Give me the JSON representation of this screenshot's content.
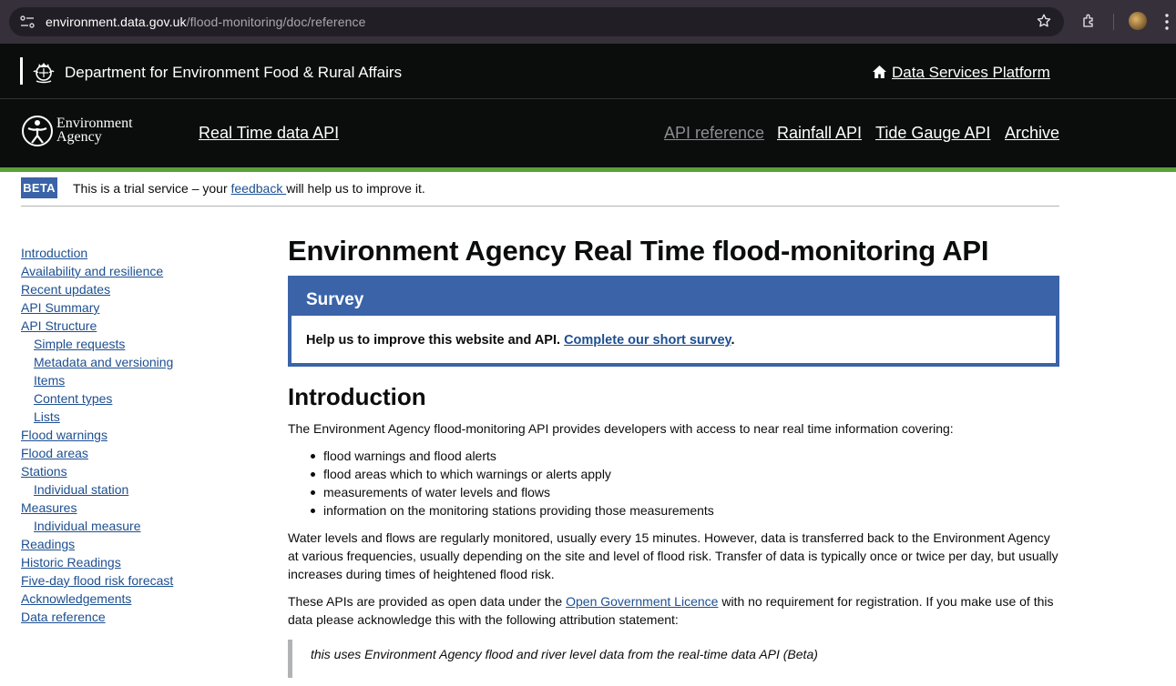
{
  "browser": {
    "url_host": "environment.data.gov.uk",
    "url_path": "/flood-monitoring/doc/reference"
  },
  "defra_header": {
    "department": "Department for Environment Food & Rural Affairs",
    "platform_link": "Data Services Platform"
  },
  "ea_header": {
    "logo_line1": "Environment",
    "logo_line2": "Agency",
    "service_name": "Real Time data API",
    "nav": [
      "API reference",
      "Rainfall API",
      "Tide Gauge API",
      "Archive"
    ],
    "active_nav": "API reference"
  },
  "beta": {
    "tag": "BETA",
    "text_before": "This is a trial service – your ",
    "link": "feedback ",
    "text_after": "will help us to improve it."
  },
  "sidebar": {
    "items": [
      {
        "label": "Introduction",
        "sub": false
      },
      {
        "label": "Availability and resilience",
        "sub": false
      },
      {
        "label": "Recent updates",
        "sub": false
      },
      {
        "label": "API Summary",
        "sub": false
      },
      {
        "label": "API Structure",
        "sub": false
      },
      {
        "label": "Simple requests",
        "sub": true
      },
      {
        "label": "Metadata and versioning",
        "sub": true
      },
      {
        "label": "Items",
        "sub": true
      },
      {
        "label": "Content types",
        "sub": true
      },
      {
        "label": "Lists",
        "sub": true
      },
      {
        "label": "Flood warnings",
        "sub": false
      },
      {
        "label": "Flood areas",
        "sub": false
      },
      {
        "label": "Stations",
        "sub": false
      },
      {
        "label": "Individual station",
        "sub": true
      },
      {
        "label": "Measures",
        "sub": false
      },
      {
        "label": "Individual measure",
        "sub": true
      },
      {
        "label": "Readings",
        "sub": false
      },
      {
        "label": "Historic Readings",
        "sub": false
      },
      {
        "label": "Five-day flood risk forecast",
        "sub": false
      },
      {
        "label": "Acknowledgements",
        "sub": false
      },
      {
        "label": "Data reference",
        "sub": false
      }
    ]
  },
  "main": {
    "title": "Environment Agency Real Time flood-monitoring API",
    "survey": {
      "heading": "Survey",
      "text": "Help us to improve this website and API. ",
      "link": "Complete our short survey",
      "after": "."
    },
    "intro_heading": "Introduction",
    "intro_para": "The Environment Agency flood-monitoring API provides developers with access to near real time information covering:",
    "bullets": [
      "flood warnings and flood alerts",
      "flood areas which to which warnings or alerts apply",
      "measurements of water levels and flows",
      "information on the monitoring stations providing those measurements"
    ],
    "para2": "Water levels and flows are regularly monitored, usually every 15 minutes. However, data is transferred back to the Environment Agency at various frequencies, usually depending on the site and level of flood risk. Transfer of data is typically once or twice per day, but usually increases during times of heightened flood risk.",
    "para3_before": "These APIs are provided as open data under the ",
    "para3_link": "Open Government Licence",
    "para3_after": " with no requirement for registration. If you make use of this data please acknowledge this with the following attribution statement:",
    "quote": "this uses Environment Agency flood and river level data from the real-time data API (Beta)"
  },
  "colors": {
    "header_bg": "#0b0c0c",
    "ea_green": "#5aa13a",
    "brand_blue": "#3a63a8",
    "link": "#1d4f91"
  },
  "icons": [
    "site-info-icon",
    "star-icon",
    "extensions-icon",
    "avatar",
    "menu-dots-icon",
    "crest-icon",
    "home-icon",
    "ea-logo-icon"
  ]
}
